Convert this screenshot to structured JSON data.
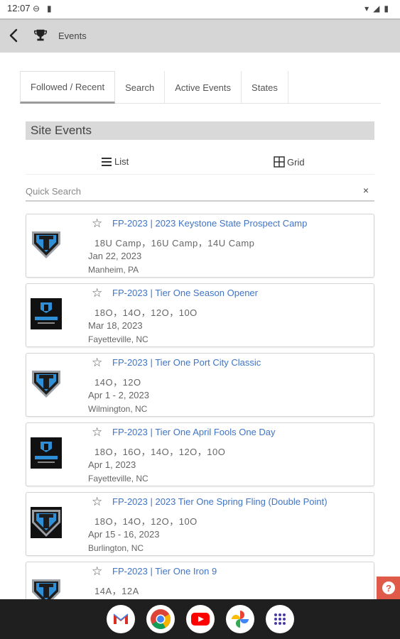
{
  "status_bar": {
    "time": "12:07"
  },
  "app_bar": {
    "title": "Events",
    "trophy_icon": "trophy-icon",
    "back_icon": "back-arrow-icon"
  },
  "tabs": [
    {
      "label": "Followed / Recent",
      "active": true
    },
    {
      "label": "Search",
      "active": false
    },
    {
      "label": "Active Events",
      "active": false
    },
    {
      "label": "States",
      "active": false
    }
  ],
  "section": {
    "title": "Site Events"
  },
  "view_toggle": {
    "list_label": "List",
    "grid_label": "Grid"
  },
  "search": {
    "placeholder": "Quick Search",
    "value": "",
    "clear_label": "×"
  },
  "events": [
    {
      "name": "FP-2023 | 2023 Keystone State Prospect Camp",
      "divisions": "18U Camp，16U Camp，14U Camp",
      "date": "Jan 22, 2023",
      "location": "Manheim, PA",
      "logo": "shield"
    },
    {
      "name": "FP-2023 | Tier One Season Opener",
      "divisions": "18O，14O，12O，10O",
      "date": "Mar 18, 2023",
      "location": "Fayetteville, NC",
      "logo": "dark"
    },
    {
      "name": "FP-2023 | Tier One Port City Classic",
      "divisions": "14O，12O",
      "date": "Apr 1 - 2, 2023",
      "location": "Wilmington, NC",
      "logo": "shield"
    },
    {
      "name": "FP-2023 | Tier One April Fools One Day",
      "divisions": "18O，16O，14O，12O，10O",
      "date": "Apr 1, 2023",
      "location": "Fayetteville, NC",
      "logo": "dark"
    },
    {
      "name": "FP-2023 | 2023 Tier One Spring Fling (Double Point)",
      "divisions": "18O，14O，12O，10O",
      "date": "Apr 15 - 16, 2023",
      "location": "Burlington, NC",
      "logo": "framed"
    },
    {
      "name": "FP-2023 | Tier One Iron 9",
      "divisions": "14A，12A",
      "date": "",
      "location": "",
      "logo": "shield"
    }
  ],
  "colors": {
    "link": "#3f74c7",
    "section_bg": "#d9d9d9",
    "help_button": "#e05a4a",
    "logo_blue": "#2f8fd6"
  },
  "dock_apps": [
    "gmail-icon",
    "chrome-icon",
    "youtube-icon",
    "photos-icon",
    "app-drawer-icon"
  ]
}
